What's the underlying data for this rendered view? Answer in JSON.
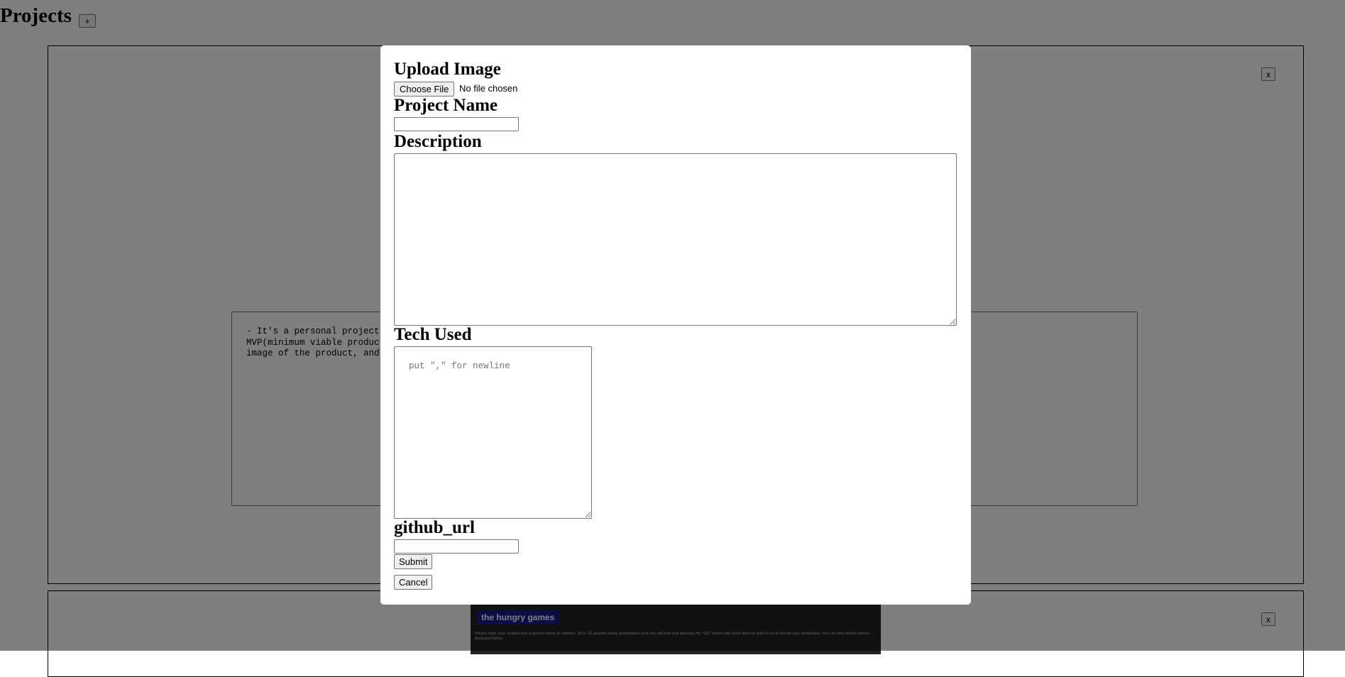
{
  "page": {
    "title": "Projects",
    "add_label": "+",
    "close_label": "x"
  },
  "card1": {
    "description": "- It's a personal project for learning React, Redux, and Firebase. It was a lot of fun. Most importantly, I met my\nMVP(minimum viable product) goal. It is a simple e-commerce site where the admin can add products, upload an\nimage of the product, and users can buy products."
  },
  "card2": {
    "preview_title": "the hungry games",
    "preview_text": "Please enter your location and a search radius (in metres). Up to 20 popular eating destinations near you will load and pressing the \"Go!\" button will cause them to duke it out to decide your destination. You can also delete options displayed below."
  },
  "modal": {
    "upload_label": "Upload Image",
    "choose_file": "Choose File",
    "file_status": "No file chosen",
    "project_name_label": "Project Name",
    "project_name_value": "",
    "description_label": "Description",
    "description_value": "",
    "tech_label": "Tech Used",
    "tech_placeholder": "put \",\" for newline",
    "github_label": "github_url",
    "github_value": "",
    "submit_label": "Submit",
    "cancel_label": "Cancel"
  },
  "colors": {
    "overlay": "rgba(0,0,0,0.5)",
    "preview_bg": "#222222",
    "preview_title_bg": "#1a1a8c"
  }
}
